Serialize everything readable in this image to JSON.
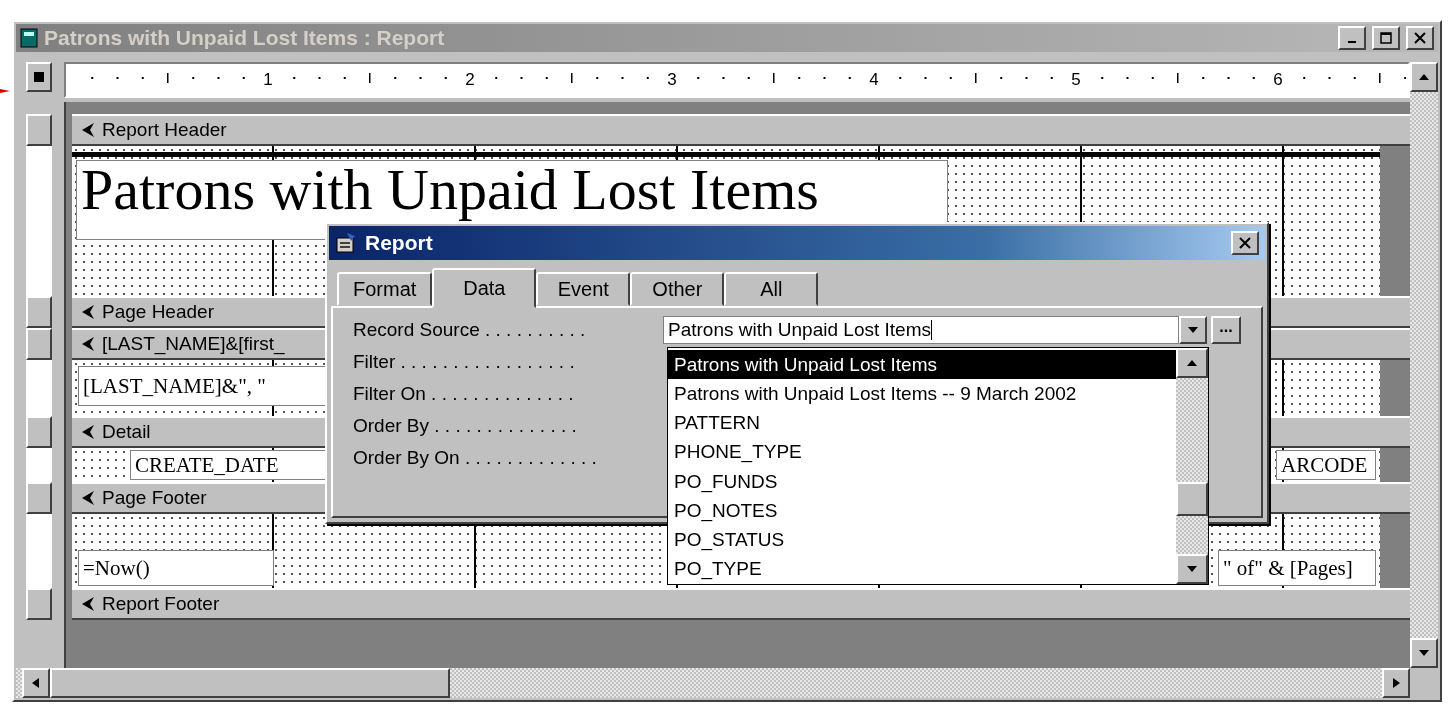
{
  "window": {
    "title": "Patrons with Unpaid Lost Items : Report"
  },
  "ruler": {
    "marks": [
      "1",
      "2",
      "3",
      "4",
      "5",
      "6"
    ]
  },
  "sections": [
    {
      "title": "Report Header",
      "controls": [
        {
          "kind": "title",
          "text": "Patrons with Unpaid Lost Items"
        }
      ]
    },
    {
      "title": "Page Header"
    },
    {
      "title": "[LAST_NAME]&[first_",
      "controls": [
        {
          "kind": "field",
          "text": "[LAST_NAME]&\", \""
        }
      ]
    },
    {
      "title": "Detail",
      "controls": [
        {
          "kind": "field",
          "text": "CREATE_DATE"
        },
        {
          "kind": "field",
          "text": "ARCODE"
        }
      ]
    },
    {
      "title": "Page Footer",
      "controls": [
        {
          "kind": "field",
          "text": "=Now()"
        },
        {
          "kind": "field",
          "text": "\" of\" & [Pages]"
        }
      ]
    },
    {
      "title": "Report Footer"
    }
  ],
  "dialog": {
    "title": "Report",
    "tabs": [
      {
        "label": "Format",
        "selected": false
      },
      {
        "label": "Data",
        "selected": true
      },
      {
        "label": "Event",
        "selected": false
      },
      {
        "label": "Other",
        "selected": false
      },
      {
        "label": "All",
        "selected": false
      }
    ],
    "properties": [
      {
        "label": "Record Source . . . . . . . . . ."
      },
      {
        "label": "Filter . . . . . . . . . . . . . . . . ."
      },
      {
        "label": "Filter On . . . . . . . . . . . . . ."
      },
      {
        "label": "Order By . . . . . . . . . . . . . ."
      },
      {
        "label": "Order By On . . . . . . . . . . . . ."
      }
    ],
    "record_source": {
      "value": "Patrons with Unpaid Lost Items",
      "build_button": "..."
    },
    "dropdown": {
      "items": [
        {
          "text": "Patrons with Unpaid Lost Items",
          "selected": true
        },
        {
          "text": "Patrons with Unpaid Lost Items -- 9 March 2002",
          "selected": false
        },
        {
          "text": "PATTERN",
          "selected": false
        },
        {
          "text": "PHONE_TYPE",
          "selected": false
        },
        {
          "text": "PO_FUNDS",
          "selected": false
        },
        {
          "text": "PO_NOTES",
          "selected": false
        },
        {
          "text": "PO_STATUS",
          "selected": false
        },
        {
          "text": "PO_TYPE",
          "selected": false
        }
      ]
    }
  }
}
